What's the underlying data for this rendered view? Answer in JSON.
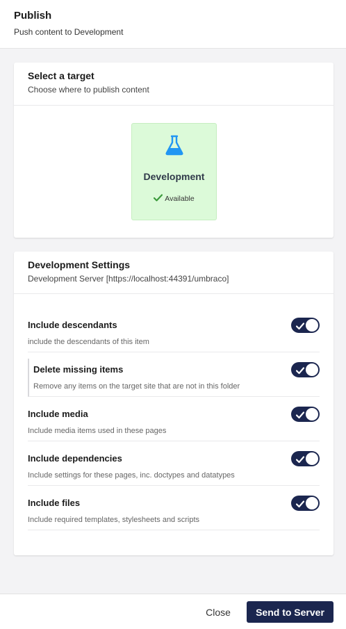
{
  "header": {
    "title": "Publish",
    "subtitle": "Push content to Development"
  },
  "target_panel": {
    "title": "Select a target",
    "subtitle": "Choose where to publish content",
    "target": {
      "name": "Development",
      "status": "Available",
      "icon": "flask-icon",
      "status_icon": "checkmark-icon",
      "icon_color": "#2196f3",
      "background": "#dcfad9"
    }
  },
  "settings_panel": {
    "title": "Development Settings",
    "subtitle": "Development Server [https://localhost:44391/umbraco]",
    "items": [
      {
        "label": "Include descendants",
        "description": "include the descendants of this item",
        "enabled": true
      },
      {
        "label": "Delete missing items",
        "description": "Remove any items on the target site that are not in this folder",
        "enabled": true
      },
      {
        "label": "Include media",
        "description": "Include media items used in these pages",
        "enabled": true
      },
      {
        "label": "Include dependencies",
        "description": "Include settings for these pages, inc. doctypes and datatypes",
        "enabled": true
      },
      {
        "label": "Include files",
        "description": "Include required templates, stylesheets and scripts",
        "enabled": true
      }
    ]
  },
  "footer": {
    "close_label": "Close",
    "send_label": "Send to Server"
  },
  "colors": {
    "primary": "#1b264f",
    "success": "#3c9a3c",
    "accent_icon": "#2196f3"
  }
}
